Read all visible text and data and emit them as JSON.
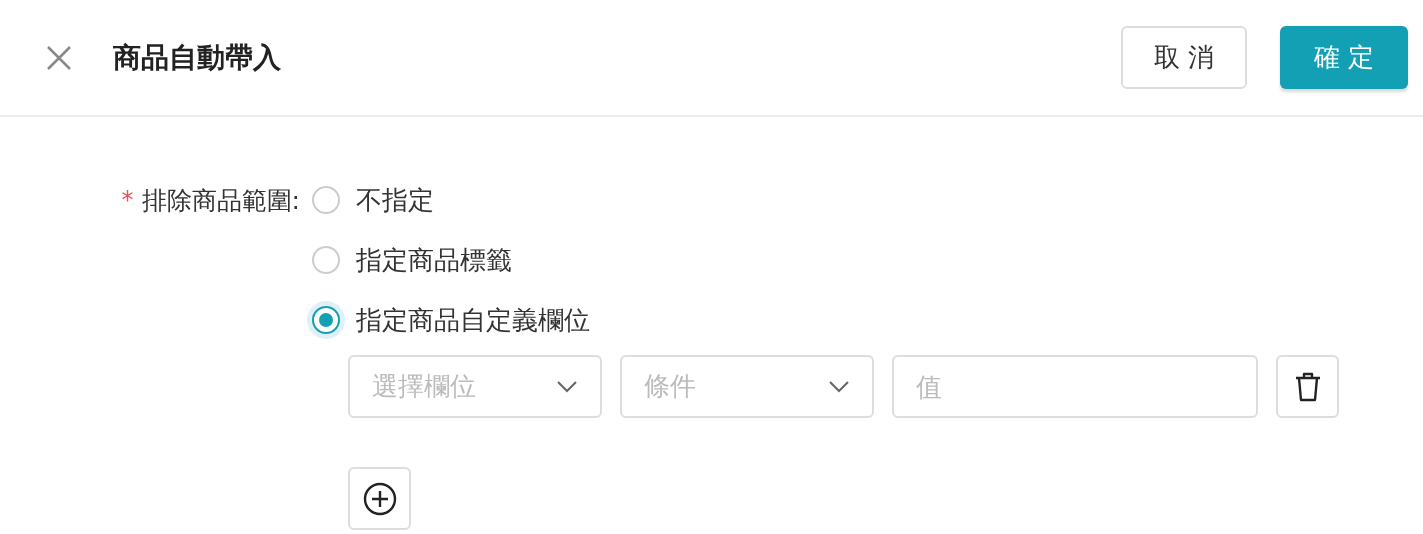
{
  "header": {
    "title": "商品自動帶入",
    "buttons": [
      {
        "label": "取 消",
        "kind": "secondary"
      },
      {
        "label": "確 定",
        "kind": "primary"
      }
    ]
  },
  "form": {
    "required_mark": "*",
    "label": "排除商品範圍:",
    "options": [
      {
        "label": "不指定",
        "selected": false
      },
      {
        "label": "指定商品標籤",
        "selected": false
      },
      {
        "label": "指定商品自定義欄位",
        "selected": true
      }
    ],
    "condition_row": {
      "field_select": {
        "placeholder": "選擇欄位"
      },
      "condition_select": {
        "placeholder": "條件"
      },
      "value_input": {
        "placeholder": "值"
      }
    }
  }
}
